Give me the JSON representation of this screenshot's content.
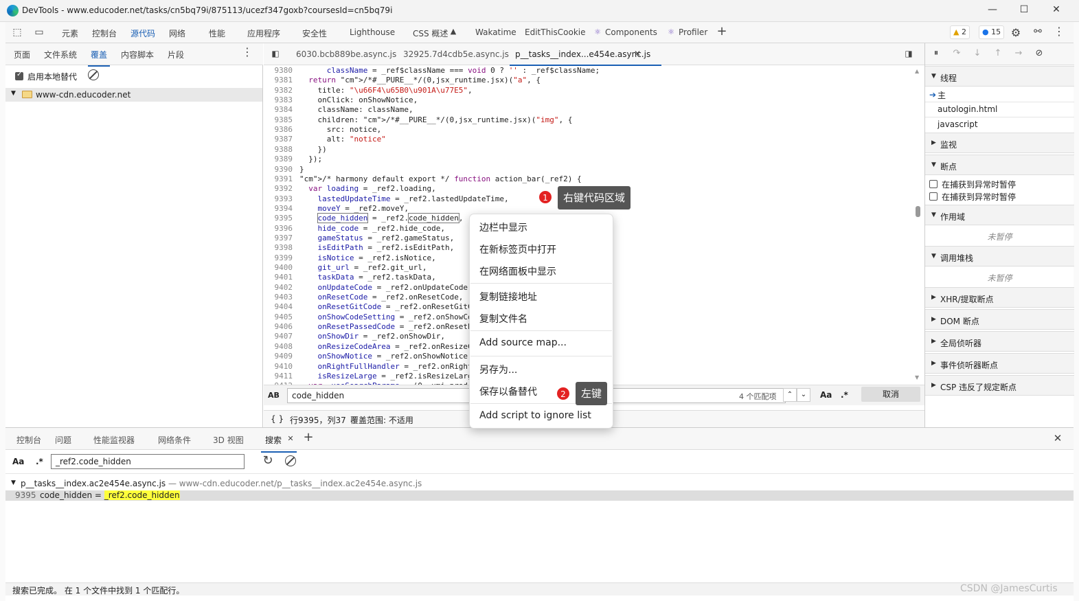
{
  "window": {
    "title": "DevTools - www.educoder.net/tasks/cn5bq79i/875113/ucezf347goxb?coursesId=cn5bq79i",
    "minimize": "—",
    "maximize": "☐",
    "close": "✕"
  },
  "main_tabs": [
    "元素",
    "控制台",
    "源代码",
    "网络",
    "性能",
    "应用程序",
    "安全性",
    "Lighthouse",
    "CSS 概述",
    "Wakatime",
    "EditThisCookie",
    "Components",
    "Profiler"
  ],
  "badges": {
    "warnings": "2",
    "issues": "15"
  },
  "left_panel": {
    "tabs": [
      "页面",
      "文件系统",
      "覆盖",
      "内容脚本",
      "片段"
    ],
    "more": "⋮",
    "enable_override_label": "启用本地替代",
    "tree_item": "www-cdn.educoder.net"
  },
  "editor": {
    "file_tabs": [
      "6030.bcb889be.async.js",
      "32925.7d4cdb5e.async.js",
      "p__tasks__index...e454e.async.js"
    ],
    "lines": [
      {
        "n": "9380",
        "t": "      className = _ref$className === void 0 ? '' : _ref$className;"
      },
      {
        "n": "9381",
        "t": "  return /*#__PURE__*/(0,jsx_runtime.jsx)(\"a\", {"
      },
      {
        "n": "9382",
        "t": "    title: \"\\u66F4\\u65B0\\u901A\\u77E5\","
      },
      {
        "n": "9383",
        "t": "    onClick: onShowNotice,"
      },
      {
        "n": "9384",
        "t": "    className: className,"
      },
      {
        "n": "9385",
        "t": "    children: /*#__PURE__*/(0,jsx_runtime.jsx)(\"img\", {"
      },
      {
        "n": "9386",
        "t": "      src: notice,"
      },
      {
        "n": "9387",
        "t": "      alt: \"notice\""
      },
      {
        "n": "9388",
        "t": "    })"
      },
      {
        "n": "9389",
        "t": "  });"
      },
      {
        "n": "9390",
        "t": "}"
      },
      {
        "n": "9391",
        "t": "/* harmony default export */ function action_bar(_ref2) {"
      },
      {
        "n": "9392",
        "t": "  var loading = _ref2.loading,"
      },
      {
        "n": "9393",
        "t": "    lastedUpdateTime = _ref2.lastedUpdateTime,"
      },
      {
        "n": "9394",
        "t": "    moveY = _ref2.moveY,"
      },
      {
        "n": "9395",
        "t": "    code_hidden = _ref2.code_hidden,"
      },
      {
        "n": "9396",
        "t": "    hide_code = _ref2.hide_code,"
      },
      {
        "n": "9397",
        "t": "    gameStatus = _ref2.gameStatus,"
      },
      {
        "n": "9398",
        "t": "    isEditPath = _ref2.isEditPath,"
      },
      {
        "n": "9399",
        "t": "    isNotice = _ref2.isNotice,"
      },
      {
        "n": "9400",
        "t": "    git_url = _ref2.git_url,"
      },
      {
        "n": "9401",
        "t": "    taskData = _ref2.taskData,"
      },
      {
        "n": "9402",
        "t": "    onUpdateCode = _ref2.onUpdateCode,"
      },
      {
        "n": "9403",
        "t": "    onResetCode = _ref2.onResetCode,"
      },
      {
        "n": "9404",
        "t": "    onResetGitCode = _ref2.onResetGitCode,"
      },
      {
        "n": "9405",
        "t": "    onShowCodeSetting = _ref2.onShowCodeSetting,"
      },
      {
        "n": "9406",
        "t": "    onResetPassedCode = _ref2.onResetPassedCode,"
      },
      {
        "n": "9407",
        "t": "    onShowDir = _ref2.onShowDir,"
      },
      {
        "n": "9408",
        "t": "    onResizeCodeArea = _ref2.onResizeCodeArea,"
      },
      {
        "n": "9409",
        "t": "    onShowNotice = _ref2.onShowNotice,"
      },
      {
        "n": "9410",
        "t": "    onRightFullHandler = _ref2.onRightFullHandler,"
      },
      {
        "n": "9411",
        "t": "    isResizeLarge = _ref2.isResizeLarge,"
      },
      {
        "n": "9412",
        "t": "  var _useSearchParams = (0,_umi_prod"
      }
    ],
    "search_value": "code_hidden",
    "match_count": "4 个匹配项",
    "aa": "Aa",
    "regex": ".*",
    "cancel": "取消",
    "status_braces": "{ }",
    "status_position": "行9395，列37",
    "status_coverage": "覆盖范围: 不适用"
  },
  "right_panel": {
    "sections": [
      "线程",
      "监视",
      "断点",
      "作用域",
      "调用堆栈",
      "XHR/提取断点",
      "DOM 断点",
      "全局侦听器",
      "事件侦听器断点",
      "CSP 违反了规定断点"
    ],
    "threads": [
      "主",
      "autologin.html",
      "javascript"
    ],
    "breakpoint_options": [
      "在捕获到异常时暂停",
      "在捕获到异常时暂停"
    ],
    "not_paused": "未暂停"
  },
  "drawer": {
    "tabs": [
      "控制台",
      "问题",
      "性能监视器",
      "网络条件",
      "3D 视图",
      "搜索"
    ],
    "aa": "Aa",
    "regex": ".*",
    "search_value": "_ref2.code_hidden",
    "result_file": "p__tasks__index.ac2e454e.async.js",
    "result_sep": " — ",
    "result_path": "www-cdn.educoder.net/p__tasks__index.ac2e454e.async.js",
    "result_line": "9395",
    "result_prefix": "code_hidden = ",
    "result_match": "_ref2.code_hidden",
    "status": "搜索已完成。 在 1 个文件中找到 1 个匹配行。"
  },
  "context_menu": {
    "items": [
      "边栏中显示",
      "在新标签页中打开",
      "在网络面板中显示",
      "复制链接地址",
      "复制文件名",
      "Add source map...",
      "另存为...",
      "保存以备替代",
      "Add script to ignore list"
    ]
  },
  "annotations": [
    {
      "num": "1",
      "text": "右键代码区域"
    },
    {
      "num": "2",
      "text": "左键"
    }
  ],
  "watermark": "CSDN @JamesCurtis",
  "colors": {
    "accent": "#1a5fb4",
    "highlight": "#ffff3b",
    "callout": "#555555",
    "marker": "#e32222"
  }
}
